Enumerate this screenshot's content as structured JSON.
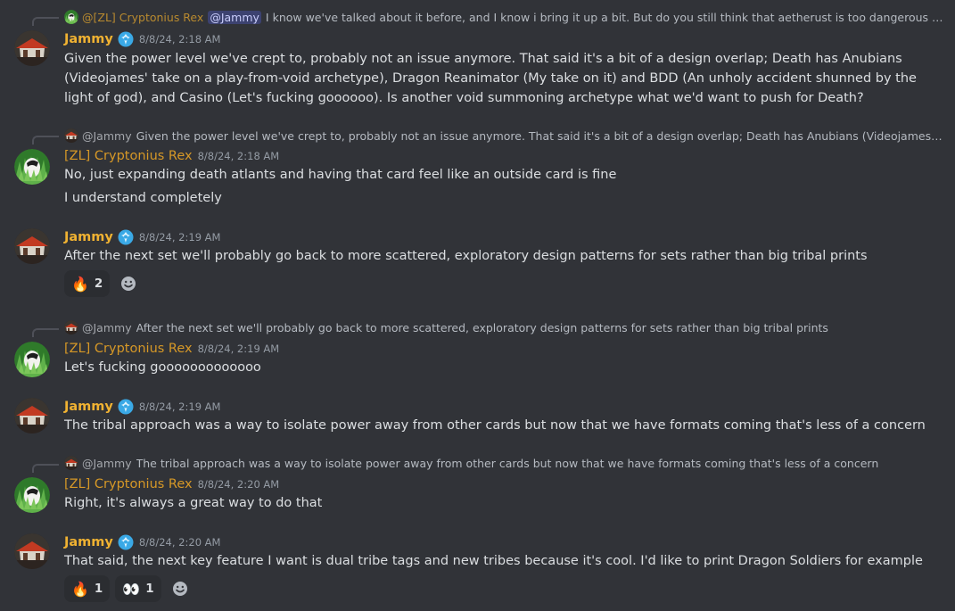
{
  "users": {
    "jammy": {
      "name": "Jammy",
      "badge_icon": "blue-flower-badge-icon",
      "color": "#f0b232"
    },
    "rex": {
      "name": "[ZL] Cryptonius Rex",
      "reply_name": "@[ZL] Cryptonius Rex",
      "color": "#d69827"
    }
  },
  "messages": [
    {
      "reply": {
        "author": "@[ZL] Cryptonius Rex",
        "mention": "@Jammy",
        "text": "I know we've talked about it before, and I know i bring it up a bit. But do you still think that aetherust is too dangerous to allow f..."
      },
      "author": "Jammy",
      "time": "8/8/24, 2:18 AM",
      "lines": [
        "Given the power level we've crept to, probably not an issue anymore. That said it's a bit of a design overlap; Death has Anubians (Videojames' take on a play-from-void archetype), Dragon Reanimator (My take on it) and BDD (An unholy accident shunned by the light of god), and Casino (Let's fucking goooooo). Is another void summoning archetype what we'd want to push for Death?"
      ]
    },
    {
      "reply": {
        "author": "@Jammy",
        "text": "Given the power level we've crept to, probably not an issue anymore. That said it's a bit of a design overlap; Death has Anubians (Videojames' take on a ..."
      },
      "author": "[ZL] Cryptonius Rex",
      "time": "8/8/24, 2:18 AM",
      "lines": [
        "No, just expanding death atlants and having that card feel like an outside card is fine",
        "I understand completely"
      ]
    },
    {
      "author": "Jammy",
      "time": "8/8/24, 2:19 AM",
      "lines": [
        "After the next set we'll probably go back to more scattered, exploratory design patterns for sets rather than big tribal prints"
      ],
      "reactions": [
        {
          "emoji": "🔥",
          "count": "2"
        }
      ]
    },
    {
      "reply": {
        "author": "@Jammy",
        "text": "After the next set we'll probably go back to more scattered, exploratory design patterns for sets rather than big tribal prints"
      },
      "author": "[ZL] Cryptonius Rex",
      "time": "8/8/24, 2:19 AM",
      "lines": [
        "Let's fucking gooooooooooooo"
      ]
    },
    {
      "author": "Jammy",
      "time": "8/8/24, 2:19 AM",
      "lines": [
        "The tribal approach was a way to isolate power away from other cards but now that we have formats coming that's less of a concern"
      ]
    },
    {
      "reply": {
        "author": "@Jammy",
        "text": "The tribal approach was a way to isolate power away from other cards but now that we have formats coming that's less of a concern"
      },
      "author": "[ZL] Cryptonius Rex",
      "time": "8/8/24, 2:20 AM",
      "lines": [
        "Right, it's always a great way to do that"
      ]
    },
    {
      "author": "Jammy",
      "time": "8/8/24, 2:20 AM",
      "lines": [
        "That said, the next key feature I want is dual tribe tags and new tribes because it's cool. I'd like to print Dragon Soldiers for example"
      ],
      "reactions": [
        {
          "emoji": "🔥",
          "count": "1"
        },
        {
          "emoji": "👀",
          "count": "1"
        }
      ]
    }
  ],
  "icons": {
    "add_reaction": "smiley-add-reaction-icon",
    "jammy_avatar": "red-barn-avatar-icon",
    "rex_avatar": "grass-creature-avatar-icon"
  },
  "colors": {
    "background": "#313338",
    "mention_bg": "#3c4270",
    "reaction_bg": "#2b2d31"
  }
}
